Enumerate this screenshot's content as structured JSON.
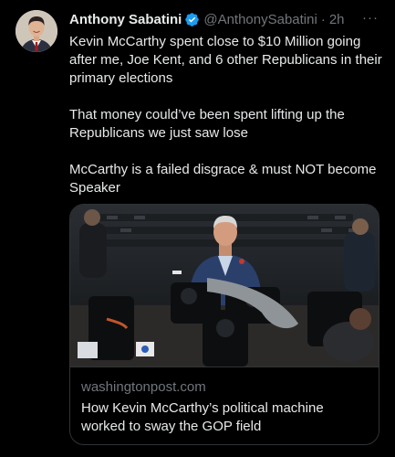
{
  "tweet": {
    "display_name": "Anthony Sabatini",
    "handle": "@AnthonySabatini",
    "separator": "·",
    "time": "2h",
    "more_label": "···",
    "paragraphs": [
      "Kevin McCarthy spent close to $10 Million going after me, Joe Kent, and 6 other Republicans in their primary elections",
      "That money could’ve been spent lifting up the Republicans we just saw lose",
      "McCarthy is a failed disgrace & must NOT become Speaker"
    ]
  },
  "link_card": {
    "domain": "washingtonpost.com",
    "title": "How Kevin McCarthy’s political machine worked to sway the GOP field"
  },
  "colors": {
    "background": "#000000",
    "text_primary": "#e7e9ea",
    "text_secondary": "#71767b",
    "verified_badge": "#1d9bf0",
    "border": "#2f3336"
  },
  "icons": {
    "verified": "verified-badge-icon",
    "more": "more-options-icon"
  }
}
